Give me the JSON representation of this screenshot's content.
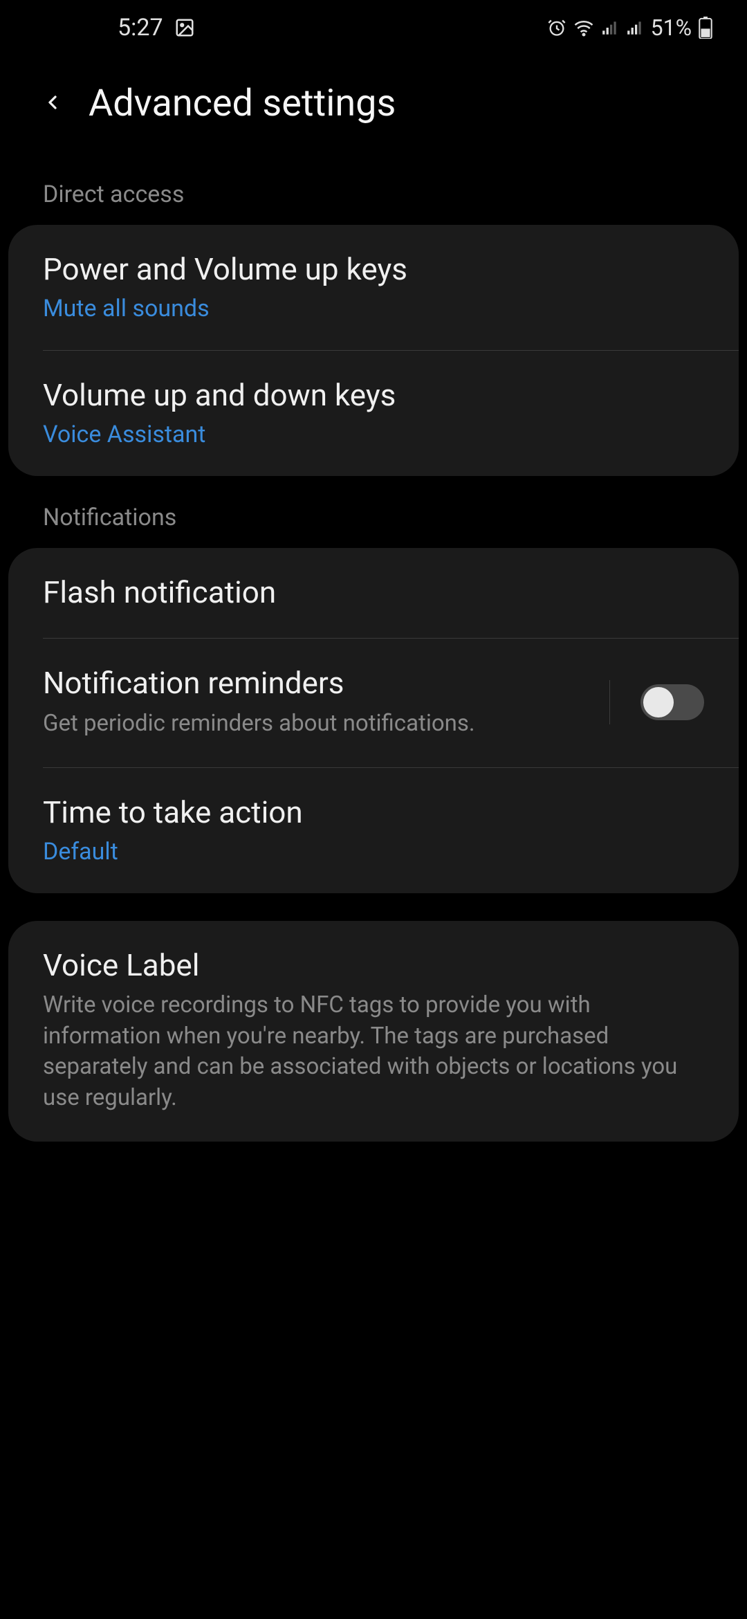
{
  "status_bar": {
    "time": "5:27",
    "battery_text": "51%"
  },
  "header": {
    "title": "Advanced settings"
  },
  "sections": {
    "direct_access": {
      "label": "Direct access",
      "items": [
        {
          "title": "Power and Volume up keys",
          "subtitle": "Mute all sounds"
        },
        {
          "title": "Volume up and down keys",
          "subtitle": "Voice Assistant"
        }
      ]
    },
    "notifications": {
      "label": "Notifications",
      "items": [
        {
          "title": "Flash notification"
        },
        {
          "title": "Notification reminders",
          "desc": "Get periodic reminders about notifications.",
          "toggle": false
        },
        {
          "title": "Time to take action",
          "subtitle": "Default"
        }
      ]
    },
    "voice_label": {
      "items": [
        {
          "title": "Voice Label",
          "desc": "Write voice recordings to NFC tags to provide you with information when you're nearby. The tags are purchased separately and can be associated with objects or locations you use regularly."
        }
      ]
    }
  },
  "colors": {
    "accent_link": "#3a8cdd",
    "card_bg": "#1b1b1b",
    "bg": "#000000"
  }
}
